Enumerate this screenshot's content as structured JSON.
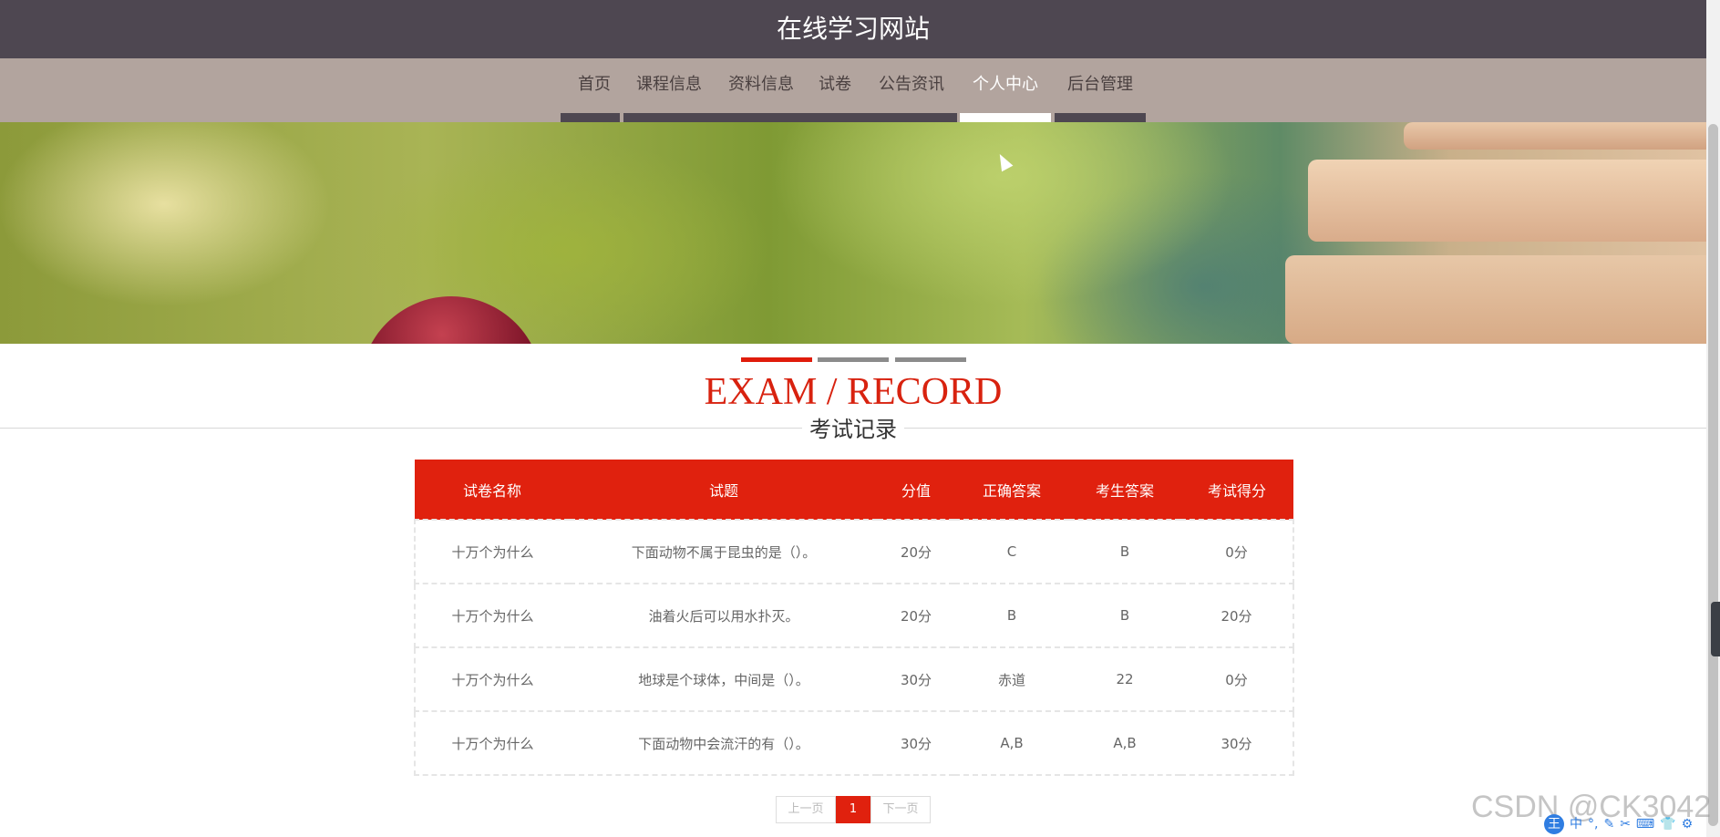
{
  "site": {
    "title": "在线学习网站"
  },
  "nav": {
    "items": [
      {
        "label": "首页",
        "active": false
      },
      {
        "label": "课程信息",
        "active": false
      },
      {
        "label": "资料信息",
        "active": false
      },
      {
        "label": "试卷",
        "active": false
      },
      {
        "label": "公告资讯",
        "active": false
      },
      {
        "label": "个人中心",
        "active": true
      },
      {
        "label": "后台管理",
        "active": false
      }
    ]
  },
  "slider": {
    "count": 3,
    "active_index": 0
  },
  "section": {
    "title_en": "EXAM / RECORD",
    "title_zh": "考试记录"
  },
  "table": {
    "headers": [
      "试卷名称",
      "试题",
      "分值",
      "正确答案",
      "考生答案",
      "考试得分"
    ],
    "rows": [
      [
        "十万个为什么",
        "下面动物不属于昆虫的是（）。",
        "20分",
        "C",
        "B",
        "0分"
      ],
      [
        "十万个为什么",
        "油着火后可以用水扑灭。",
        "20分",
        "B",
        "B",
        "20分"
      ],
      [
        "十万个为什么",
        "地球是个球体，中间是（）。",
        "30分",
        "赤道",
        "22",
        "0分"
      ],
      [
        "十万个为什么",
        "下面动物中会流汗的有（）。",
        "30分",
        "A,B",
        "A,B",
        "30分"
      ]
    ]
  },
  "pagination": {
    "prev": "上一页",
    "current": "1",
    "next": "下一页"
  },
  "watermark": "CSDN @CK3042",
  "ime": {
    "logo": "王",
    "icons": [
      "中",
      "°,",
      "✎",
      "✂",
      "⌨",
      "👕",
      "⚙"
    ]
  },
  "colors": {
    "accent": "#e0210e",
    "header_bg": "#4e4751",
    "nav_bg": "#b2a49e"
  }
}
